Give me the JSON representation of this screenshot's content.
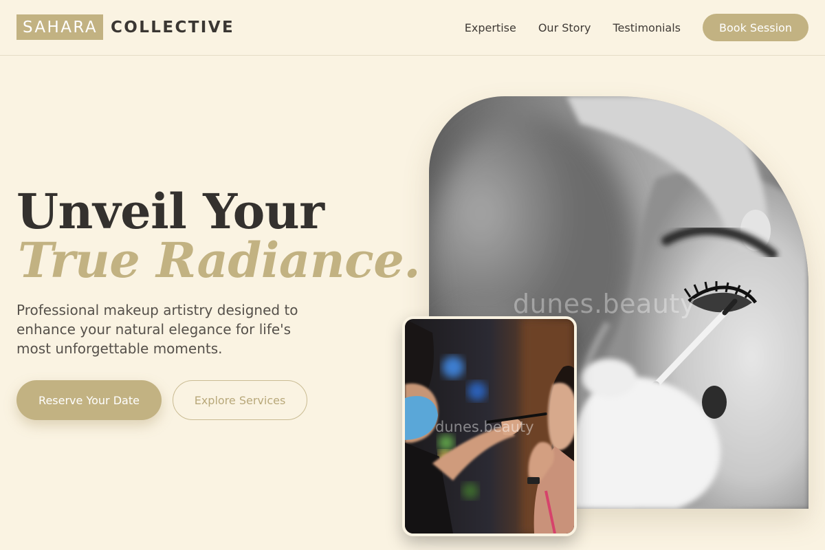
{
  "brand": {
    "boxed": "SAHARA",
    "text": "COLLECTIVE"
  },
  "nav": {
    "links": [
      "Expertise",
      "Our Story",
      "Testimonials"
    ],
    "cta": "Book Session"
  },
  "hero": {
    "title_line1": "Unveil Your",
    "title_line2": "True Radiance.",
    "subtitle": "Professional makeup artistry designed to enhance your natural elegance for life's most unforgettable moments.",
    "primary_button": "Reserve Your Date",
    "secondary_button": "Explore Services"
  },
  "images": {
    "main_watermark": "dunes.beauty",
    "inset_watermark": "dunes.beauty"
  },
  "colors": {
    "background": "#faf3e2",
    "accent": "#c2b282",
    "text_dark": "#34312e"
  }
}
